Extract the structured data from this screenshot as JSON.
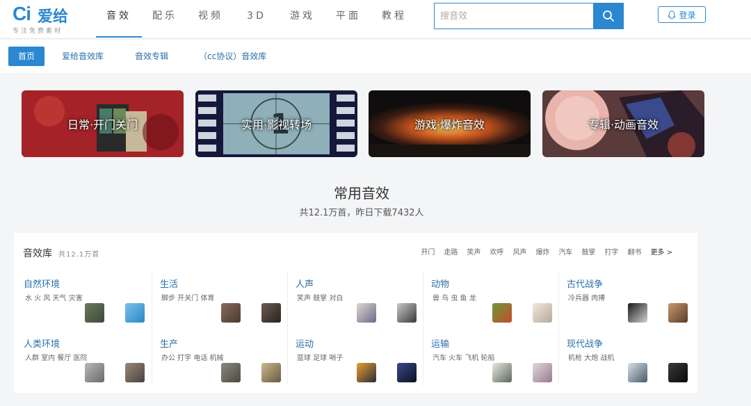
{
  "header": {
    "logo_mark": "Ci",
    "logo_name": "爱给",
    "logo_slogan": "专注免费素材",
    "nav": [
      {
        "label": "音效",
        "active": true
      },
      {
        "label": "配乐",
        "active": false
      },
      {
        "label": "视频",
        "active": false
      },
      {
        "label": "3D",
        "active": false
      },
      {
        "label": "游戏",
        "active": false
      },
      {
        "label": "平面",
        "active": false
      },
      {
        "label": "教程",
        "active": false
      }
    ],
    "search_placeholder": "搜音效",
    "search_icon": "search-icon",
    "login_label": "登录",
    "login_icon": "qq-penguin-icon"
  },
  "subnav": [
    {
      "label": "首页",
      "active": true
    },
    {
      "label": "爱给音效库",
      "active": false
    },
    {
      "label": "音效专辑",
      "active": false
    },
    {
      "label": "（cc协议）音效库",
      "active": false
    }
  ],
  "banners": [
    {
      "label": "日常·开门关门"
    },
    {
      "label": "实用·影视转场"
    },
    {
      "label": "游戏·爆炸音效"
    },
    {
      "label": "专辑·动画音效"
    }
  ],
  "section": {
    "title": "常用音效",
    "subtitle": "共12.1万首，昨日下载7432人"
  },
  "library": {
    "title": "音效库",
    "count": "共12.1万首",
    "tags": [
      "开门",
      "走路",
      "笑声",
      "欢呼",
      "风声",
      "爆炸",
      "汽车",
      "鼓掌",
      "打字",
      "翻书"
    ],
    "more_label": "更多 >",
    "categories": [
      {
        "name": "自然环境",
        "desc": "水 火 风 天气 灾害"
      },
      {
        "name": "生活",
        "desc": "脚步 开关门 体育"
      },
      {
        "name": "人声",
        "desc": "笑声 鼓掌 对白"
      },
      {
        "name": "动物",
        "desc": "兽 鸟 虫 鱼 龙"
      },
      {
        "name": "古代战争",
        "desc": "冷兵器 肉搏"
      },
      {
        "name": "人类环境",
        "desc": "人群 室内 餐厅 医院"
      },
      {
        "name": "生产",
        "desc": "办公 打字 电话 机械"
      },
      {
        "name": "运动",
        "desc": "篮球 足球 哨子"
      },
      {
        "name": "运输",
        "desc": "汽车 火车 飞机 轮船"
      },
      {
        "name": "现代战争",
        "desc": "机枪 大炮 战机"
      }
    ]
  }
}
